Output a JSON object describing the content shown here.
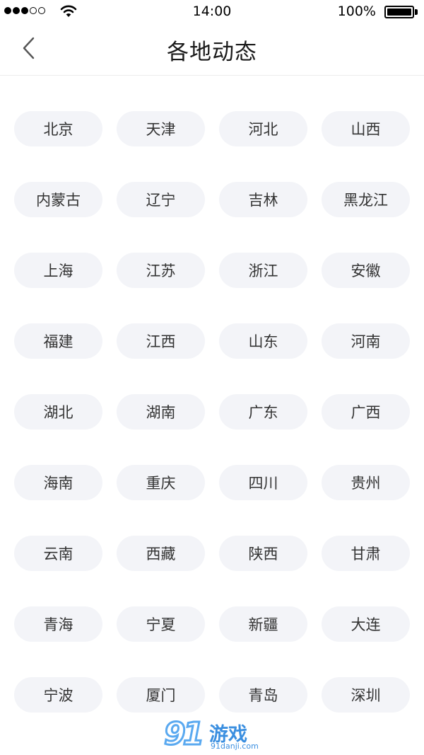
{
  "status_bar": {
    "time": "14:00",
    "battery_percent": "100%",
    "signal_strength": 3,
    "signal_total": 5
  },
  "nav": {
    "title": "各地动态",
    "back_icon": "chevron-left-icon"
  },
  "regions": [
    "北京",
    "天津",
    "河北",
    "山西",
    "内蒙古",
    "辽宁",
    "吉林",
    "黑龙江",
    "上海",
    "江苏",
    "浙江",
    "安徽",
    "福建",
    "江西",
    "山东",
    "河南",
    "湖北",
    "湖南",
    "广东",
    "广西",
    "海南",
    "重庆",
    "四川",
    "贵州",
    "云南",
    "西藏",
    "陕西",
    "甘肃",
    "青海",
    "宁夏",
    "新疆",
    "大连",
    "宁波",
    "厦门",
    "青岛",
    "深圳"
  ],
  "watermark": {
    "number": "91",
    "text": "游戏",
    "url": "91danji.com"
  },
  "colors": {
    "chip_background": "#f3f4f8",
    "chip_text": "#333333",
    "title_text": "#1a1a1a"
  }
}
